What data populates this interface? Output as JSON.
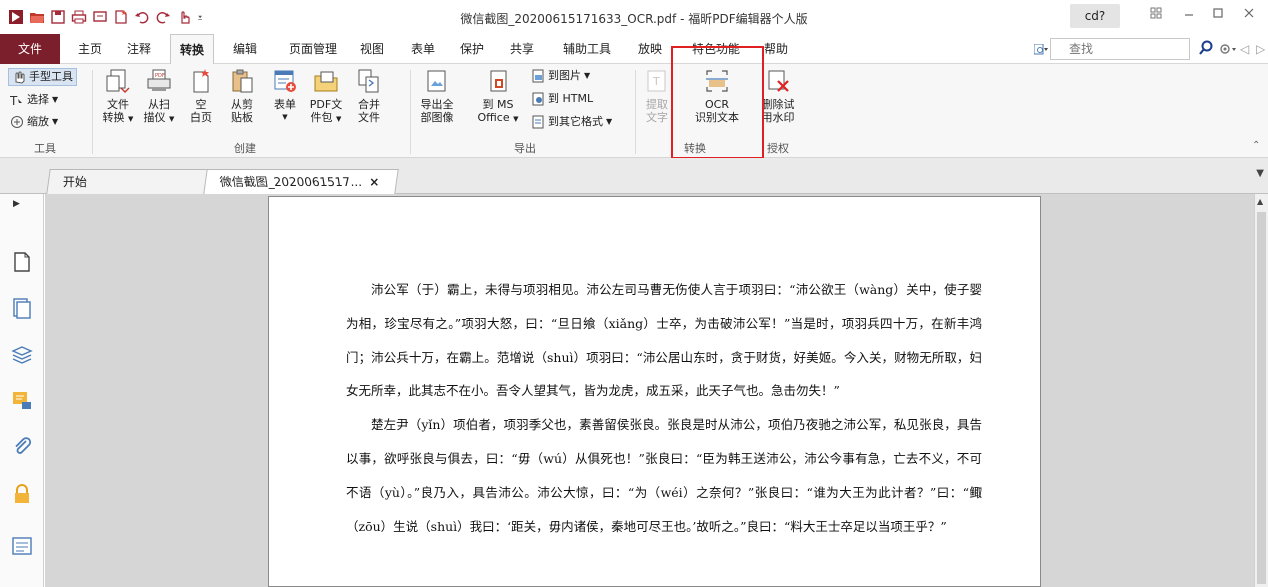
{
  "titlebar": {
    "title": "微信截图_20200615171633_OCR.pdf - 福昕PDF编辑器个人版",
    "user": "cd?",
    "qat_icons": [
      "app-logo-icon",
      "open-folder-icon",
      "save-icon",
      "print-icon",
      "screen-icon",
      "new-doc-icon",
      "undo-icon",
      "redo-icon",
      "hand-pointer-icon",
      "dropdown-icon"
    ]
  },
  "menu": {
    "tabs": [
      "文件",
      "主页",
      "注释",
      "转换",
      "编辑",
      "页面管理",
      "视图",
      "表单",
      "保护",
      "共享",
      "辅助工具",
      "放映",
      "特色功能",
      "帮助"
    ],
    "active": "转换",
    "search_placeholder": "查找"
  },
  "ribbon": {
    "tools": {
      "hand": "手型工具",
      "select": "选择",
      "zoom": "缩放",
      "group": "工具"
    },
    "create": {
      "file_convert_1": "文件",
      "file_convert_2": "转换",
      "scanner_1": "从扫",
      "scanner_2": "描仪",
      "blank_1": "空",
      "blank_2": "白页",
      "clipboard_1": "从剪",
      "clipboard_2": "贴板",
      "form_1": "表单",
      "package_1": "PDF文",
      "package_2": "件包",
      "merge_1": "合并",
      "merge_2": "文件",
      "group": "创建"
    },
    "export": {
      "export_all_1": "导出全",
      "export_all_2": "部图像",
      "ms_office_1": "到 MS",
      "ms_office_2": "Office",
      "to_image": "到图片",
      "to_html": "到 HTML",
      "to_other": "到其它格式",
      "group": "导出"
    },
    "convert": {
      "extract_1": "提取",
      "extract_2": "文字",
      "ocr_1": "OCR",
      "ocr_2": "识别文本",
      "group": "转换"
    },
    "protect": {
      "watermark_1": "删除试",
      "watermark_2": "用水印",
      "group": "授权"
    }
  },
  "doc_tabs": {
    "home": "开始",
    "doc": "微信截图_2020061517...",
    "close": "×"
  },
  "sidebar": {
    "icons": [
      "pages-icon",
      "page-thumbnails-icon",
      "layers-icon",
      "comments-icon",
      "attachments-icon",
      "security-icon",
      "form-fields-icon"
    ]
  },
  "document": {
    "paragraphs": [
      {
        "indent": true,
        "text": "沛公军（于）霸上，未得与项羽相见。沛公左司马曹无伤使人言于项羽曰：“沛公欲王（wàng）关中，使子婴为相，珍宝尽有之。”项羽大怒，曰：“旦日飨（xiǎng）士卒，为击破沛公军！”当是时，项羽兵四十万，在新丰鸿门；沛公兵十万，在霸上。范增说（shuì）项羽曰：“沛公居山东时，贪于财货，好美姬。今入关，财物无所取，妇女无所幸，此其志不在小。吾令人望其气，皆为龙虎，成五采，此天子气也。急击勿失！”"
      },
      {
        "indent": true,
        "text": "楚左尹（yǐn）项伯者，项羽季父也，素善留侯张良。张良是时从沛公，项伯乃夜驰之沛公军，私见张良，具告以事，欲呼张良与俱去，曰：“毋（wú）从俱死也！”张良曰：“臣为韩王送沛公，沛公今事有急，亡去不义，不可不语（yù）。”良乃入，具告沛公。沛公大惊，曰：“为（wéi）之奈何？”张良曰：“谁为大王为此计者？”曰：“鲰（zōu）生说（shuì）我曰：‘距关，毋内诸侯，秦地可尽王也。’故听之。”良曰：“料大王士卒足以当项王乎？”"
      }
    ]
  },
  "colors": {
    "file_tab": "#7a1f2b",
    "highlight": "#e02020",
    "ribbon_bg": "#f7f7f7",
    "workspace_bg": "#d6d6d6"
  }
}
